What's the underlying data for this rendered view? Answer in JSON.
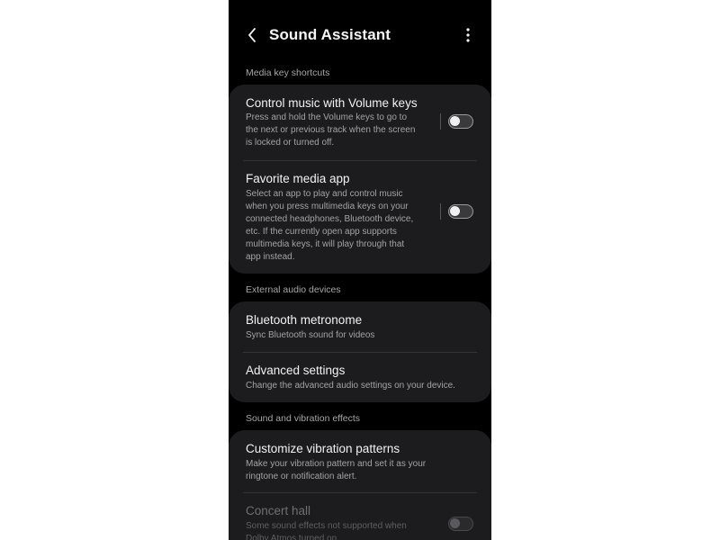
{
  "header": {
    "title": "Sound Assistant",
    "back_icon": "chevron-left-icon",
    "more_icon": "more-vertical-icon"
  },
  "sections": {
    "media_keys": {
      "header": "Media key shortcuts",
      "items": [
        {
          "title": "Control music with Volume keys",
          "desc": [
            "Press and hold the Volume keys to go to",
            "the next or previous track when the screen",
            "is locked or turned off."
          ],
          "toggle": "off"
        },
        {
          "title": "Favorite media app",
          "desc": [
            "Select an app to play and control music",
            "when you press multimedia keys on your",
            "connected headphones, Bluetooth device,",
            "etc. If the currently open app supports",
            "multimedia keys, it will play through that",
            "app instead."
          ],
          "toggle": "off"
        }
      ]
    },
    "external_audio": {
      "header": "External audio devices",
      "items": [
        {
          "title": "Bluetooth metronome",
          "desc": [
            "Sync Bluetooth sound for videos"
          ]
        },
        {
          "title": "Advanced settings",
          "desc": [
            "Change the advanced audio settings on your device."
          ]
        }
      ]
    },
    "sound_vibration": {
      "header": "Sound and vibration effects",
      "items": [
        {
          "title": "Customize vibration patterns",
          "desc": [
            "Make your vibration pattern and set it as your",
            "ringtone or notification alert."
          ]
        },
        {
          "title": "Concert hall",
          "desc": [
            "Some sound effects not supported when",
            "Dolby Atmos turned on."
          ],
          "toggle": "off",
          "disabled": true
        }
      ]
    }
  },
  "colors": {
    "background": "#000000",
    "card": "#1c1c1e",
    "text_primary": "#f2f2f2",
    "text_secondary": "#a3a3a6",
    "section_header": "#a6a6a6"
  }
}
